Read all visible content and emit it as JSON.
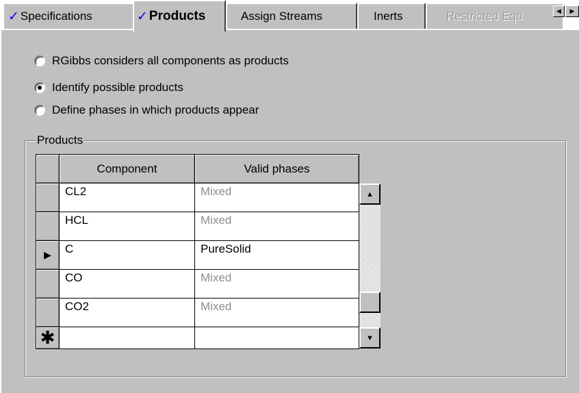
{
  "tabs": [
    {
      "label": "Specifications",
      "checked": true,
      "active": false,
      "disabled": false
    },
    {
      "label": "Products",
      "checked": true,
      "active": true,
      "disabled": false
    },
    {
      "label": "Assign Streams",
      "checked": false,
      "active": false,
      "disabled": false
    },
    {
      "label": "Inerts",
      "checked": false,
      "active": false,
      "disabled": false
    },
    {
      "label": "Restricted Equ",
      "checked": false,
      "active": false,
      "disabled": true
    }
  ],
  "check_mark": "✓",
  "tab_scroll": {
    "left": "◀",
    "right": "▶"
  },
  "radios": [
    {
      "label": "RGibbs considers all components as products",
      "checked": false
    },
    {
      "label": "Identify possible products",
      "checked": true
    },
    {
      "label": "Define phases in which products appear",
      "checked": false
    }
  ],
  "group": {
    "title": "Products"
  },
  "grid": {
    "columns": [
      "Component",
      "Valid phases"
    ],
    "rows": [
      {
        "component": "CL2",
        "phase": "Mixed",
        "phase_default": true,
        "current": false
      },
      {
        "component": "HCL",
        "phase": "Mixed",
        "phase_default": true,
        "current": false
      },
      {
        "component": "C",
        "phase": "PureSolid",
        "phase_default": false,
        "current": true
      },
      {
        "component": "CO",
        "phase": "Mixed",
        "phase_default": true,
        "current": false
      },
      {
        "component": "CO2",
        "phase": "Mixed",
        "phase_default": true,
        "current": false
      }
    ],
    "current_row_marker": "▶",
    "new_row_marker": "✱",
    "scroll_up": "▲",
    "scroll_down": "▼"
  },
  "colors": {
    "check": "#0000ff",
    "face": "#c0c0c0",
    "default_value_text": "#8c8c8c"
  }
}
